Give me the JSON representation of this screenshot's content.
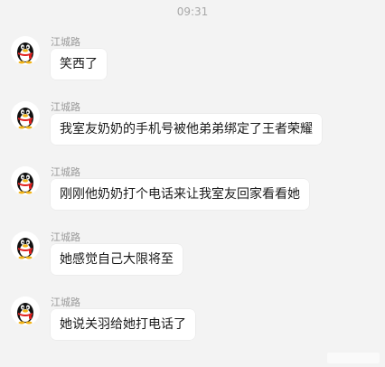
{
  "chat": {
    "timestamp": "09:31",
    "messages": [
      {
        "sender": "江城路",
        "text": "笑西了",
        "avatar_icon": "qq-penguin-icon"
      },
      {
        "sender": "江城路",
        "text": "我室友奶奶的手机号被他弟弟绑定了王者荣耀",
        "avatar_icon": "qq-penguin-icon"
      },
      {
        "sender": "江城路",
        "text": "刚刚他奶奶打个电话来让我室友回家看看她",
        "avatar_icon": "qq-penguin-icon"
      },
      {
        "sender": "江城路",
        "text": "她感觉自己大限将至",
        "avatar_icon": "qq-penguin-icon"
      },
      {
        "sender": "江城路",
        "text": "她说关羽给她打电话了",
        "avatar_icon": "qq-penguin-icon"
      }
    ]
  },
  "colors": {
    "background": "#f3f3f3",
    "bubble": "#ffffff",
    "sender_text": "#9a9a9a",
    "message_text": "#1a1a1a",
    "timestamp_text": "#a8a8a8"
  }
}
